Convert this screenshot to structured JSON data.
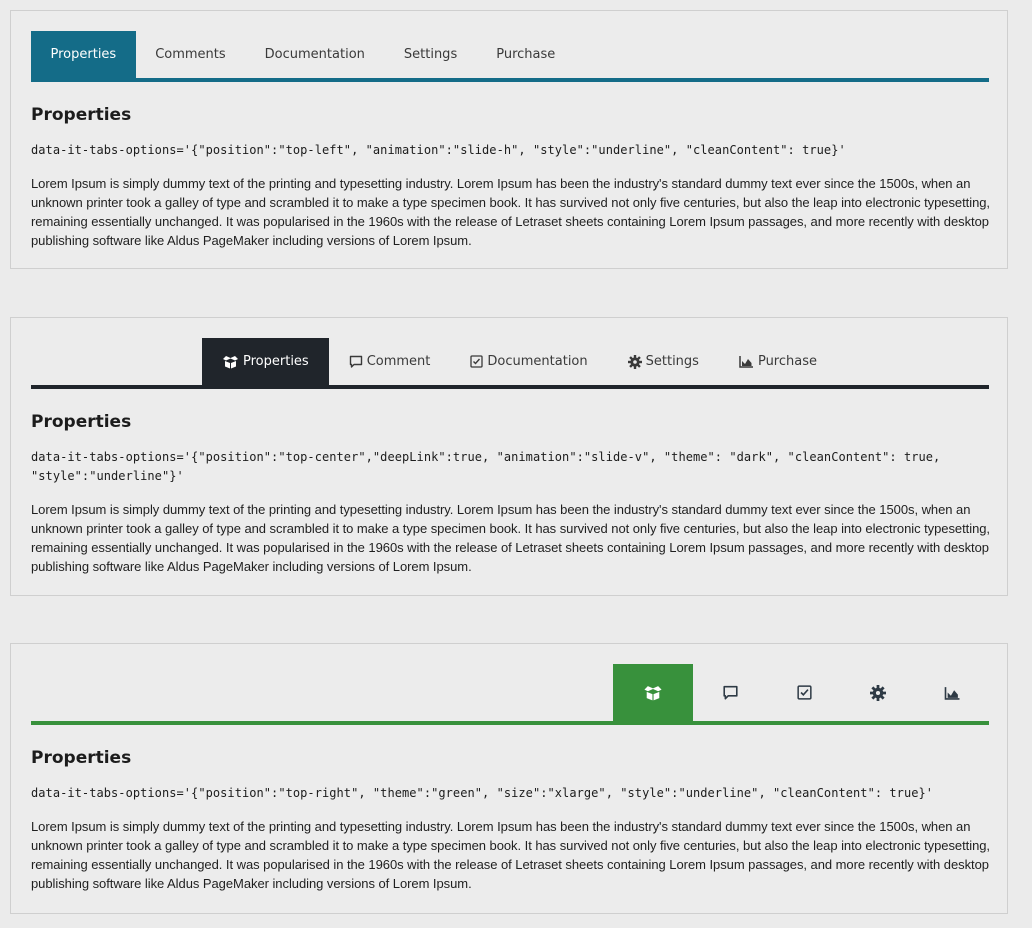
{
  "panels": [
    {
      "tabs": [
        {
          "label": "Properties"
        },
        {
          "label": "Comments"
        },
        {
          "label": "Documentation"
        },
        {
          "label": "Settings"
        },
        {
          "label": "Purchase"
        }
      ],
      "heading": "Properties",
      "code": "data-it-tabs-options='{\"position\":\"top-left\", \"animation\":\"slide-h\", \"style\":\"underline\", \"cleanContent\": true}'",
      "text": "Lorem Ipsum is simply dummy text of the printing and typesetting industry. Lorem Ipsum has been the industry's standard dummy text ever since the 1500s, when an unknown printer took a galley of type and scrambled it to make a type specimen book. It has survived not only five centuries, but also the leap into electronic typesetting, remaining essentially unchanged. It was popularised in the 1960s with the release of Letraset sheets containing Lorem Ipsum passages, and more recently with desktop publishing software like Aldus PageMaker including versions of Lorem Ipsum.",
      "accent": "#146c88"
    },
    {
      "tabs": [
        {
          "label": "Properties",
          "icon": "box-open-icon"
        },
        {
          "label": "Comment",
          "icon": "comment-icon"
        },
        {
          "label": "Documentation",
          "icon": "check-square-icon"
        },
        {
          "label": "Settings",
          "icon": "gear-icon"
        },
        {
          "label": "Purchase",
          "icon": "area-chart-icon"
        }
      ],
      "heading": "Properties",
      "code": "data-it-tabs-options='{\"position\":\"top-center\",\"deepLink\":true, \"animation\":\"slide-v\", \"theme\": \"dark\", \"cleanContent\": true, \"style\":\"underline\"}'",
      "text": "Lorem Ipsum is simply dummy text of the printing and typesetting industry. Lorem Ipsum has been the industry's standard dummy text ever since the 1500s, when an unknown printer took a galley of type and scrambled it to make a type specimen book. It has survived not only five centuries, but also the leap into electronic typesetting, remaining essentially unchanged. It was popularised in the 1960s with the release of Letraset sheets containing Lorem Ipsum passages, and more recently with desktop publishing software like Aldus PageMaker including versions of Lorem Ipsum.",
      "accent": "#20252b"
    },
    {
      "tabs": [
        {
          "icon": "box-open-icon"
        },
        {
          "icon": "comment-icon"
        },
        {
          "icon": "check-square-icon"
        },
        {
          "icon": "gear-icon"
        },
        {
          "icon": "area-chart-icon"
        }
      ],
      "heading": "Properties",
      "code": "data-it-tabs-options='{\"position\":\"top-right\", \"theme\":\"green\", \"size\":\"xlarge\", \"style\":\"underline\", \"cleanContent\": true}'",
      "text": "Lorem Ipsum is simply dummy text of the printing and typesetting industry. Lorem Ipsum has been the industry's standard dummy text ever since the 1500s, when an unknown printer took a galley of type and scrambled it to make a type specimen book. It has survived not only five centuries, but also the leap into electronic typesetting, remaining essentially unchanged. It was popularised in the 1960s with the release of Letraset sheets containing Lorem Ipsum passages, and more recently with desktop publishing software like Aldus PageMaker including versions of Lorem Ipsum.",
      "accent": "#38913c"
    }
  ]
}
